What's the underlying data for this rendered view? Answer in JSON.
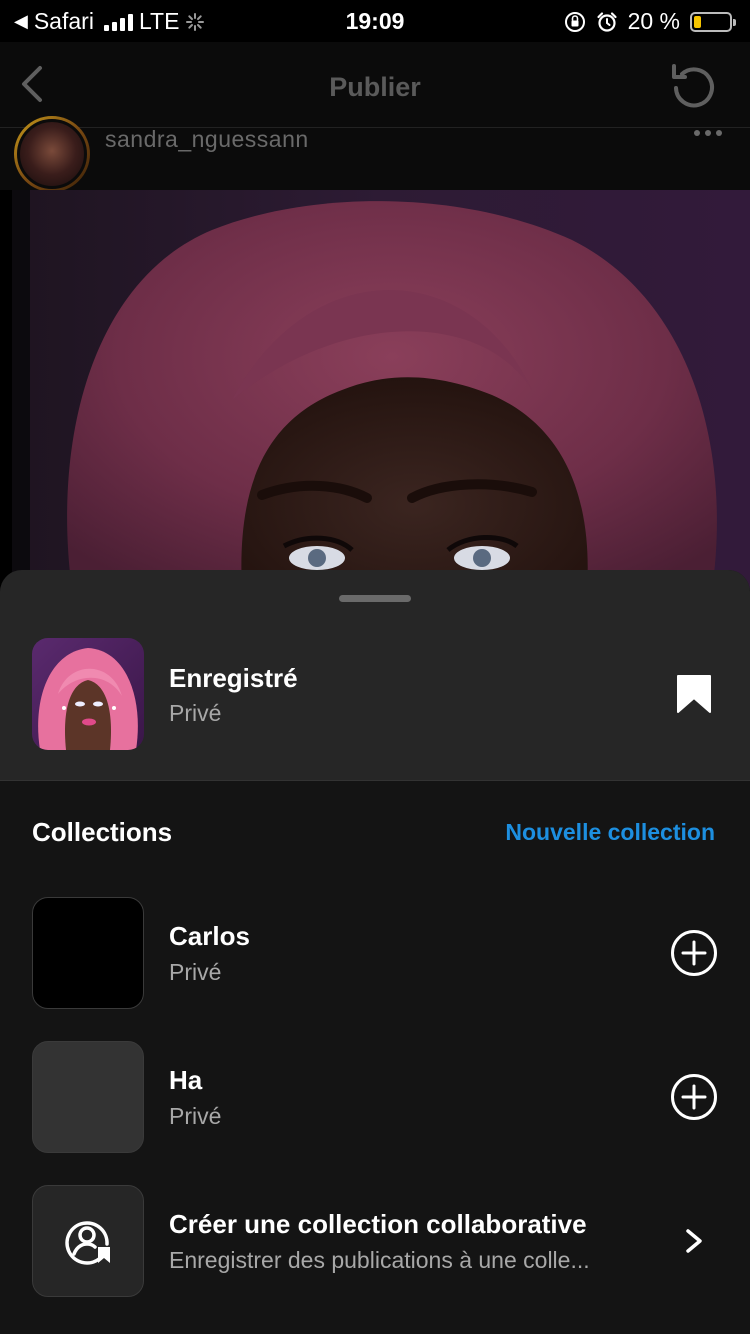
{
  "status_bar": {
    "back_app": "Safari",
    "network": "LTE",
    "time": "19:09",
    "battery_text": "20 %",
    "battery_level": 0.2,
    "battery_color": "#f5c400"
  },
  "header": {
    "title": "Publier",
    "back_icon": "chevron-left-icon",
    "reload_icon": "reload-icon"
  },
  "post": {
    "username": "sandra_nguessann",
    "more_icon": "more-dots-icon"
  },
  "sheet": {
    "saved": {
      "title": "Enregistré",
      "subtitle": "Privé",
      "icon": "bookmark-filled-icon"
    },
    "collections_title": "Collections",
    "new_collection_label": "Nouvelle collection",
    "accent_color": "#1d8fe0",
    "collections": [
      {
        "title": "Carlos",
        "subtitle": "Privé",
        "action_icon": "plus-circle-icon"
      },
      {
        "title": "Ha",
        "subtitle": "Privé",
        "action_icon": "plus-circle-icon"
      }
    ],
    "collab": {
      "title": "Créer une collection collaborative",
      "subtitle": "Enregistrer des publications à une colle...",
      "icon": "collab-user-bookmark-icon",
      "action_icon": "chevron-right-icon"
    }
  }
}
